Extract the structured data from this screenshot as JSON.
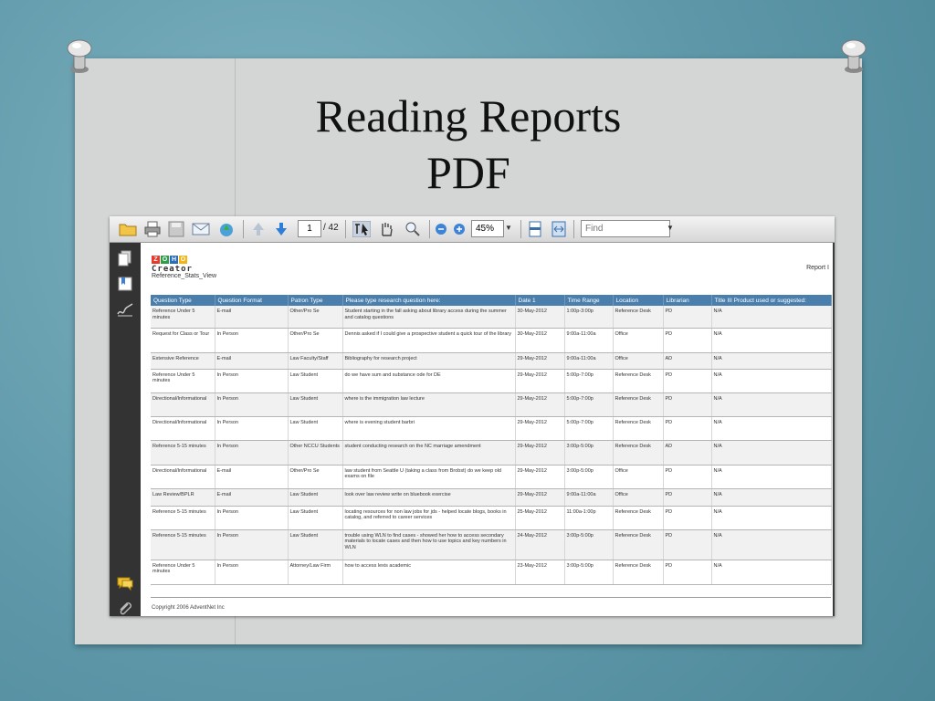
{
  "slide": {
    "title_line1": "Reading Reports",
    "title_line2": "PDF"
  },
  "viewer": {
    "page_current": "1",
    "page_total": "/ 42",
    "zoom": "45%",
    "find_placeholder": "Find",
    "toolbar_icons": [
      "open-folder-icon",
      "print-icon",
      "save-icon",
      "email-icon",
      "upload-icon",
      "previous-page-icon",
      "next-page-icon",
      "select-text-icon",
      "hand-tool-icon",
      "zoom-tool-icon",
      "zoom-out-icon",
      "zoom-in-icon",
      "fit-page-icon",
      "fit-width-icon"
    ],
    "sidebar_icons": [
      "pages-icon",
      "bookmarks-icon",
      "signatures-icon",
      "comments-icon",
      "attachments-icon"
    ]
  },
  "document": {
    "logo_letters": [
      "Z",
      "O",
      "H",
      "O"
    ],
    "logo_colors": [
      "#e8392b",
      "#2f9e4a",
      "#2a6ebb",
      "#f2b417"
    ],
    "logo_sub": "Creator",
    "view_name": "Reference_Stats_View",
    "report_link": "Report I",
    "columns": [
      "Question Type",
      "Question Format",
      "Patron Type",
      "Please type research question here:",
      "Date 1",
      "Time Range",
      "Location",
      "Librarian",
      "Title III Product used or suggested:"
    ],
    "rows": [
      [
        "Reference Under 5 minutes",
        "E-mail",
        "Other/Pro Se",
        "Student starting in the fall asking about library access during the summer and catalog questions",
        "30-May-2012",
        "1:00p-3:00p",
        "Reference Desk",
        "PD",
        "N/A"
      ],
      [
        "Request for Class or Tour",
        "In Person",
        "Other/Pro Se",
        "Dennis asked if I could give a prospective student a quick tour of the library",
        "30-May-2012",
        "9:00a-11:00a",
        "Office",
        "PD",
        "N/A"
      ],
      [
        "Extensive Reference",
        "E-mail",
        "Law Faculty/Staff",
        "Bibliography for research project",
        "29-May-2012",
        "9:00a-11:00a",
        "Office",
        "AD",
        "N/A"
      ],
      [
        "Reference Under 5 minutes",
        "In Person",
        "Law Student",
        "do we have sum and substance ode for DE",
        "29-May-2012",
        "5:00p-7:00p",
        "Reference Desk",
        "PD",
        "N/A"
      ],
      [
        "Directional/Informational",
        "In Person",
        "Law Student",
        "where is the immigration law lecture",
        "29-May-2012",
        "5:00p-7:00p",
        "Reference Desk",
        "PD",
        "N/A"
      ],
      [
        "Directional/Informational",
        "In Person",
        "Law Student",
        "where is evening student barbri",
        "29-May-2012",
        "5:00p-7:00p",
        "Reference Desk",
        "PD",
        "N/A"
      ],
      [
        "Reference 5-15 minutes",
        "In Person",
        "Other NCCU Students",
        "student conducting research on the NC marriage amendment",
        "29-May-2012",
        "3:00p-5:00p",
        "Reference Desk",
        "AD",
        "N/A"
      ],
      [
        "Directional/Informational",
        "E-mail",
        "Other/Pro Se",
        "law student from Seattle U (taking a class from Brobst) do we keep old exams on file",
        "29-May-2012",
        "3:00p-5:00p",
        "Office",
        "PD",
        "N/A"
      ],
      [
        "Law Review/BPLR",
        "E-mail",
        "Law Student",
        "look over law review write on bluebook exercise",
        "29-May-2012",
        "9:00a-11:00a",
        "Office",
        "PD",
        "N/A"
      ],
      [
        "Reference 5-15 minutes",
        "In Person",
        "Law Student",
        "locating resources for non law jobs for jds - helped locate blogs, books in catalog, and referred to career services",
        "25-May-2012",
        "11:00a-1:00p",
        "Reference Desk",
        "PD",
        "N/A"
      ],
      [
        "Reference 5-15 minutes",
        "In Person",
        "Law Student",
        "trouble using WLN to find cases - showed her how to access secondary materials to locate cases and then how to use topics and key numbers in WLN",
        "24-May-2012",
        "3:00p-5:00p",
        "Reference Desk",
        "PD",
        "N/A"
      ],
      [
        "Reference Under 5 minutes",
        "In Person",
        "Attorney/Law Firm",
        "how to access lexis academic",
        "23-May-2012",
        "3:00p-5:00p",
        "Reference Desk",
        "PD",
        "N/A"
      ]
    ],
    "footer": "Copyright 2006 AdventNet Inc"
  }
}
